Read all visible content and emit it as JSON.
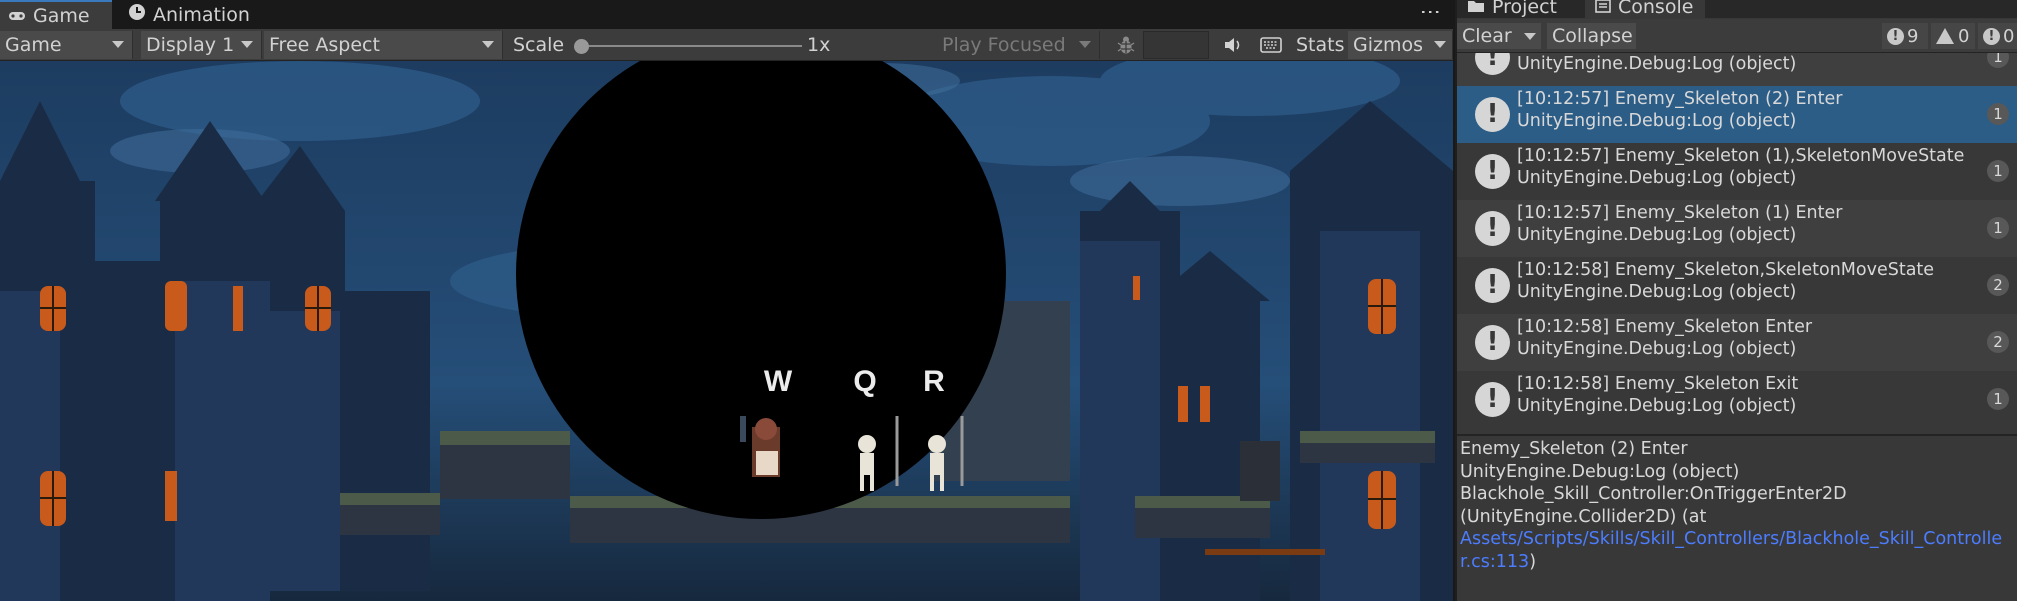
{
  "game_tabs": {
    "game_label": "Game",
    "animation_label": "Animation",
    "more_label": "⋮"
  },
  "game_toolbar": {
    "view_mode": "Game",
    "display": "Display 1",
    "aspect": "Free Aspect",
    "scale_label": "Scale",
    "scale_value": "1x",
    "play_mode": "Play Focused",
    "stats_label": "Stats",
    "gizmos_label": "Gizmos"
  },
  "scene": {
    "key_labels": [
      "W",
      "Q",
      "R"
    ]
  },
  "console_tabs": {
    "project_label": "Project",
    "console_label": "Console"
  },
  "console_toolbar": {
    "clear_label": "Clear",
    "collapse_label": "Collapse",
    "log_count": "9",
    "warning_count": "0",
    "error_count": "0"
  },
  "log_entries": [
    {
      "line1": "",
      "line2": "UnityEngine.Debug:Log (object)",
      "count": "1",
      "selected": false
    },
    {
      "line1": "[10:12:57] Enemy_Skeleton (2) Enter",
      "line2": "UnityEngine.Debug:Log (object)",
      "count": "1",
      "selected": true
    },
    {
      "line1": "[10:12:57] Enemy_Skeleton (1),SkeletonMoveState",
      "line2": "UnityEngine.Debug:Log (object)",
      "count": "1",
      "selected": false
    },
    {
      "line1": "[10:12:57] Enemy_Skeleton (1) Enter",
      "line2": "UnityEngine.Debug:Log (object)",
      "count": "1",
      "selected": false
    },
    {
      "line1": "[10:12:58] Enemy_Skeleton,SkeletonMoveState",
      "line2": "UnityEngine.Debug:Log (object)",
      "count": "2",
      "selected": false
    },
    {
      "line1": "[10:12:58] Enemy_Skeleton Enter",
      "line2": "UnityEngine.Debug:Log (object)",
      "count": "2",
      "selected": false
    },
    {
      "line1": "[10:12:58] Enemy_Skeleton Exit",
      "line2": "UnityEngine.Debug:Log (object)",
      "count": "1",
      "selected": false
    }
  ],
  "detail": {
    "line1": "Enemy_Skeleton (2) Enter",
    "line2": "UnityEngine.Debug:Log (object)",
    "line3": "Blackhole_Skill_Controller:OnTriggerEnter2D",
    "line4": "(UnityEngine.Collider2D) (at",
    "link_part1": "Assets/Scripts/Skills/Skill_Controllers/Blackhole_Skill_Controlle",
    "link_part2": "r.cs:113",
    "close_paren": ")"
  },
  "colors": {
    "accent": "#3a79bb",
    "selected_row": "#2c5d87",
    "link": "#4c7dff"
  }
}
